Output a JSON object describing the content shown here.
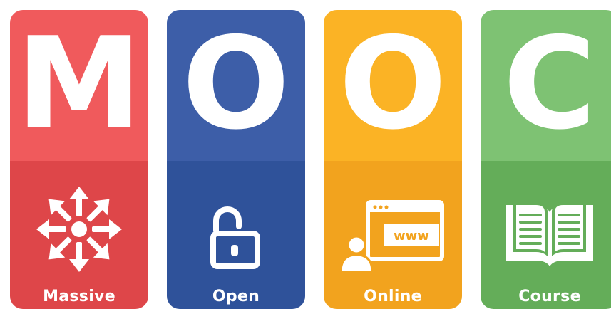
{
  "cards": [
    {
      "letter": "M",
      "label": "Massive",
      "icon": "arrows-burst-icon",
      "top_color": "#f05a5c",
      "bottom_color": "#de4649"
    },
    {
      "letter": "O",
      "label": "Open",
      "icon": "unlocked-padlock-icon",
      "top_color": "#3d5ea8",
      "bottom_color": "#2f529a"
    },
    {
      "letter": "O",
      "label": "Online",
      "icon": "web-user-icon",
      "web_text": "www",
      "top_color": "#fbb325",
      "bottom_color": "#f2a31e"
    },
    {
      "letter": "C",
      "label": "Course",
      "icon": "open-book-icon",
      "top_color": "#7ec273",
      "bottom_color": "#64ad59"
    }
  ]
}
